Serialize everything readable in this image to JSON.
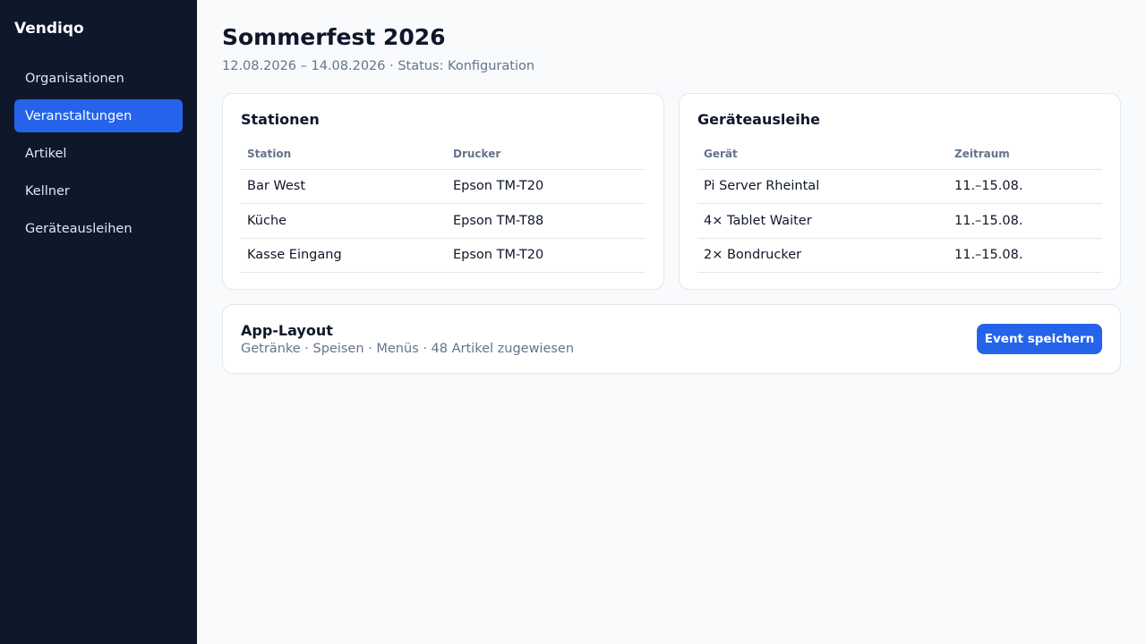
{
  "app": {
    "brand": "Vendiqo"
  },
  "sidebar": {
    "items": [
      {
        "label": "Organisationen",
        "active": false
      },
      {
        "label": "Veranstaltungen",
        "active": true
      },
      {
        "label": "Artikel",
        "active": false
      },
      {
        "label": "Kellner",
        "active": false
      },
      {
        "label": "Geräteausleihen",
        "active": false
      }
    ]
  },
  "event": {
    "title": "Sommerfest 2026",
    "subtitle": "12.08.2026 – 14.08.2026 · Status: Konfiguration"
  },
  "stations": {
    "title": "Stationen",
    "columns": [
      "Station",
      "Drucker"
    ],
    "rows": [
      [
        "Bar West",
        "Epson TM-T20"
      ],
      [
        "Küche",
        "Epson TM-T88"
      ],
      [
        "Kasse Eingang",
        "Epson TM-T20"
      ]
    ]
  },
  "devices": {
    "title": "Geräteausleihe",
    "columns": [
      "Gerät",
      "Zeitraum"
    ],
    "rows": [
      [
        "Pi Server Rheintal",
        "11.–15.08."
      ],
      [
        "4× Tablet Waiter",
        "11.–15.08."
      ],
      [
        "2× Bondrucker",
        "11.–15.08."
      ]
    ]
  },
  "app_layout": {
    "title": "App-Layout",
    "summary": "Getränke · Speisen · Menüs · 48 Artikel zugewiesen",
    "save_label": "Event speichern"
  },
  "colors": {
    "sidebar_bg": "#0f172a",
    "accent": "#2563eb",
    "page_bg": "#f8fafc",
    "muted_text": "#64748b"
  }
}
